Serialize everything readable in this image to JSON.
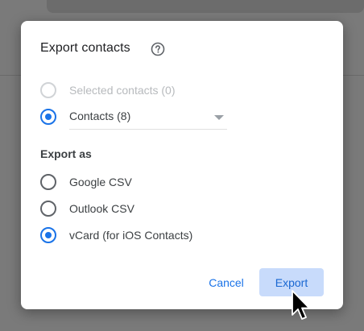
{
  "dialog": {
    "title": "Export contacts",
    "help_icon": "help-circle-icon",
    "source_options": [
      {
        "label": "Selected contacts (0)",
        "selected": false,
        "disabled": true
      },
      {
        "label": "Contacts (8)",
        "selected": true,
        "disabled": false
      }
    ],
    "export_as_heading": "Export as",
    "format_options": [
      {
        "label": "Google CSV",
        "selected": false
      },
      {
        "label": "Outlook CSV",
        "selected": false
      },
      {
        "label": "vCard (for iOS Contacts)",
        "selected": true
      }
    ],
    "cancel_label": "Cancel",
    "export_label": "Export"
  },
  "colors": {
    "accent": "#1a73e8",
    "export_button_bg": "#c8dbfb",
    "overlay": "#7a7a7a"
  },
  "cursor_icon": "arrow-pointer-icon"
}
